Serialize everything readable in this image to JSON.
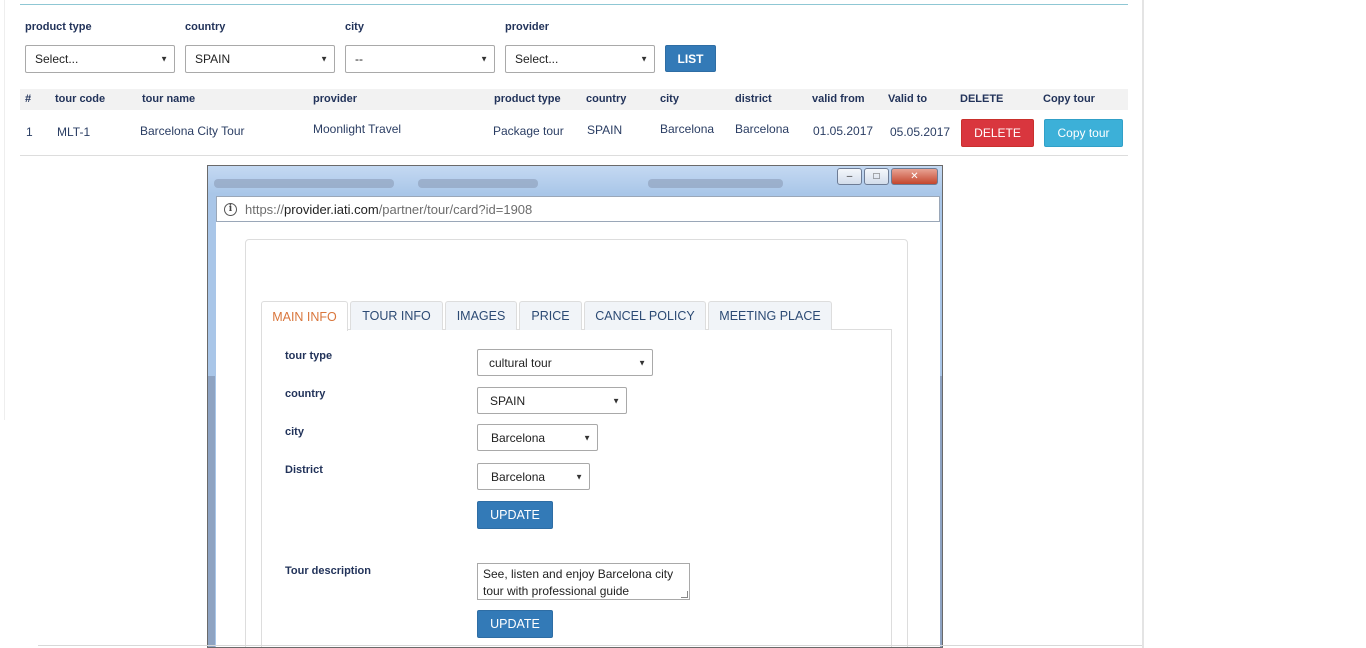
{
  "filters": {
    "product_type": {
      "label": "product type",
      "value": "Select..."
    },
    "country": {
      "label": "country",
      "value": "SPAIN"
    },
    "city": {
      "label": "city",
      "value": "--"
    },
    "provider": {
      "label": "provider",
      "value": "Select..."
    },
    "list_button": "LIST"
  },
  "table": {
    "headers": [
      "#",
      "tour code",
      "tour name",
      "provider",
      "product type",
      "country",
      "city",
      "district",
      "valid from",
      "Valid to",
      "DELETE",
      "Copy tour"
    ],
    "rows": [
      {
        "num": "1",
        "tour_code": "MLT-1",
        "tour_name": "Barcelona City Tour",
        "provider": "Moonlight Travel",
        "product_type": "Package tour",
        "country": "SPAIN",
        "city": "Barcelona",
        "district": "Barcelona",
        "valid_from": "01.05.2017",
        "valid_to": "05.05.2017",
        "delete_label": "DELETE",
        "copy_label": "Copy tour"
      }
    ]
  },
  "popup": {
    "url_prefix": "https://",
    "url_host": "provider.iati.com",
    "url_path": "/partner/tour/card?id=1908",
    "window_controls": {
      "minimize": "–",
      "maximize": "□",
      "close": "✕"
    },
    "tabs": [
      "MAIN INFO",
      "TOUR INFO",
      "IMAGES",
      "PRICE",
      "CANCEL POLICY",
      "MEETING PLACE"
    ],
    "active_tab": "MAIN INFO",
    "form": {
      "tour_type": {
        "label": "tour type",
        "value": "cultural tour"
      },
      "country": {
        "label": "country",
        "value": "SPAIN"
      },
      "city": {
        "label": "city",
        "value": "Barcelona"
      },
      "district": {
        "label": "District",
        "value": "Barcelona"
      },
      "update_label": "UPDATE",
      "description": {
        "label": "Tour description",
        "value": "See, listen and enjoy Barcelona city tour with professional guide"
      },
      "update2_label": "UPDATE"
    }
  },
  "icons": {
    "caret": "caret-down-icon",
    "info": "info-icon",
    "grip": "resize-grip-icon"
  },
  "colors": {
    "primary": "#337ab7",
    "danger": "#d9363e",
    "info": "#3cb0d8",
    "active_tab": "#d9763c"
  }
}
